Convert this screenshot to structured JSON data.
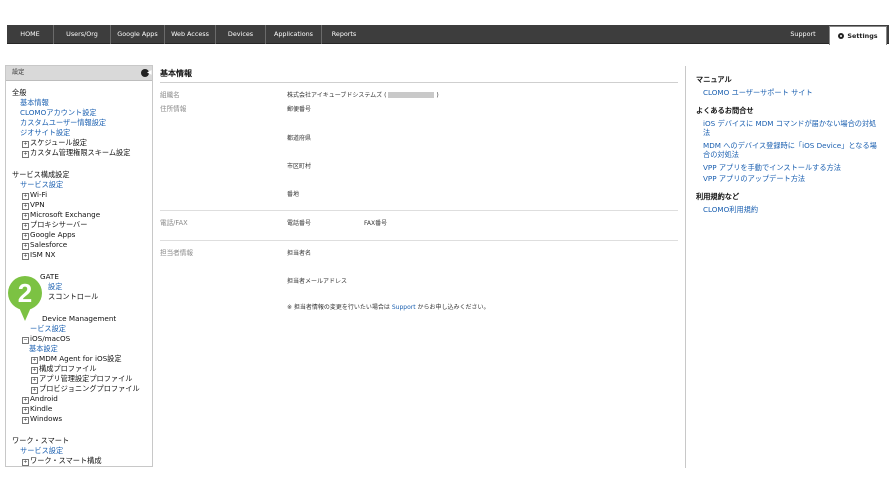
{
  "topnav": {
    "items": [
      "HOME",
      "Users/Org",
      "Google Apps",
      "Web Access",
      "Devices",
      "Applications",
      "Reports"
    ],
    "support": "Support",
    "settings": "Settings"
  },
  "sidebar": {
    "header": "設定",
    "collapse_glyph": "◀",
    "marker": "2",
    "rows": [
      {
        "text": "全般",
        "kind": "head"
      },
      {
        "text": "基本情報",
        "kind": "link"
      },
      {
        "text": "CLOMOアカウント設定",
        "kind": "link"
      },
      {
        "text": "カスタムユーザー情報設定",
        "kind": "link"
      },
      {
        "text": "ジオサイト設定",
        "kind": "link"
      },
      {
        "text": "スケジュール設定",
        "kind": "item"
      },
      {
        "text": "カスタム管理権限スキーム設定",
        "kind": "item"
      },
      {
        "text": "サービス構成設定",
        "kind": "head"
      },
      {
        "text": "サービス設定",
        "kind": "link"
      },
      {
        "text": "Wi-Fi",
        "kind": "item"
      },
      {
        "text": "VPN",
        "kind": "item"
      },
      {
        "text": "Microsoft Exchange",
        "kind": "item"
      },
      {
        "text": "プロキシサーバー",
        "kind": "item"
      },
      {
        "text": "Google Apps",
        "kind": "item"
      },
      {
        "text": "Salesforce",
        "kind": "item"
      },
      {
        "text": "ISM NX",
        "kind": "item"
      },
      {
        "text": "GATE",
        "kind": "head"
      },
      {
        "text": "設定",
        "kind": "link"
      },
      {
        "text": "スコントロール",
        "kind": "item"
      },
      {
        "text": "Device Management",
        "kind": "head"
      },
      {
        "text": "ービス設定",
        "kind": "link"
      },
      {
        "text": "iOS/macOS",
        "kind": "item"
      },
      {
        "text": "基本設定",
        "kind": "link"
      },
      {
        "text": "MDM Agent for iOS設定",
        "kind": "item"
      },
      {
        "text": "構成プロファイル",
        "kind": "item"
      },
      {
        "text": "アプリ管理設定プロファイル",
        "kind": "item"
      },
      {
        "text": "プロビジョニングプロファイル",
        "kind": "item"
      },
      {
        "text": "Android",
        "kind": "item"
      },
      {
        "text": "Kindle",
        "kind": "item"
      },
      {
        "text": "Windows",
        "kind": "item"
      },
      {
        "text": "ワーク・スマート",
        "kind": "head"
      },
      {
        "text": "サービス設定",
        "kind": "link"
      },
      {
        "text": "ワーク・スマート構成",
        "kind": "item"
      }
    ]
  },
  "main": {
    "title": "基本情報",
    "org_label": "組織名",
    "org_value_prefix": "株式会社アイキューブドシステムズ (",
    "org_value_suffix": ")",
    "address_label": "住所情報",
    "postal": "郵便番号",
    "prefecture": "都道府県",
    "city": "市区町村",
    "street": "番地",
    "phone_label": "電話/FAX",
    "phone": "電話番号",
    "fax": "FAX番号",
    "contact_label": "担当者情報",
    "contact_name": "担当者名",
    "contact_email": "担当者メールアドレス",
    "note_prefix": "※ 担当者情報の変更を行いたい場合は ",
    "note_link": "Support",
    "note_suffix": " からお申し込みください。"
  },
  "right": {
    "manual_heading": "マニュアル",
    "manual_link": "CLOMO ユーザーサポート サイト",
    "faq_heading": "よくあるお問合せ",
    "faq_links": [
      "iOS デバイスに MDM コマンドが届かない場合の対処法",
      "MDM へのデバイス登録時に「iOS Device」となる場合の対処法",
      "VPP アプリを手動でインストールする方法",
      "VPP アプリのアップデート方法"
    ],
    "terms_heading": "利用規約など",
    "terms_link": "CLOMO利用規約"
  }
}
